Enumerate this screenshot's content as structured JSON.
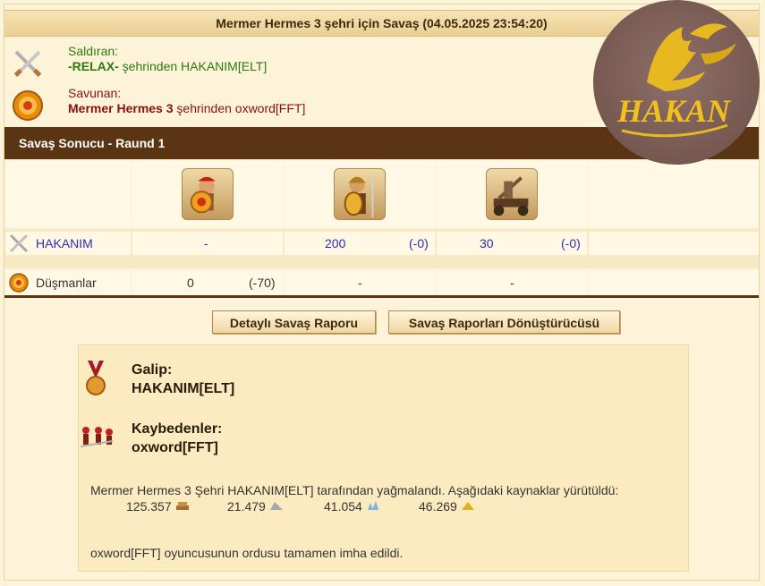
{
  "title": "Mermer Hermes 3 şehri için Savaş (04.05.2025 23:54:20)",
  "attacker": {
    "label": "Saldıran:",
    "city": "-RELAX-",
    "rest": " şehrinden HAKANIM[ELT]",
    "icon": "crossed-swords-icon"
  },
  "defender": {
    "label": "Savunan:",
    "city": "Mermer Hermes 3",
    "rest": " şehrinden oxword[FFT]",
    "icon": "shield-icon"
  },
  "result_title": "Savaş Sonucu - Raund 1",
  "units": [
    {
      "name": "unit-shield-warrior",
      "icon": "shield-warrior-icon"
    },
    {
      "name": "unit-spearman",
      "icon": "spearman-icon"
    },
    {
      "name": "unit-catapult",
      "icon": "catapult-icon"
    }
  ],
  "rows": {
    "attacker": {
      "name": "HAKANIM",
      "cells": [
        "-",
        "200",
        "(-0)",
        "30",
        "(-0)"
      ]
    },
    "defender": {
      "name": "Düşmanlar",
      "cells": [
        "0",
        "(-70)",
        "-",
        "-"
      ]
    }
  },
  "buttons": {
    "detail": "Detaylı Savaş Raporu",
    "converter": "Savaş Raporları Dönüştürücüsü"
  },
  "summary": {
    "winner_label": "Galip:",
    "winner": "HAKANIM[ELT]",
    "loser_label": "Kaybedenler:",
    "loser": "oxword[FFT]",
    "plunder_text": "Mermer Hermes 3 Şehri HAKANIM[ELT] tarafından yağmalandı. Aşağıdaki kaynaklar yürütüldü:",
    "resources": [
      {
        "value": "125.357",
        "icon": "wood-icon"
      },
      {
        "value": "21.479",
        "icon": "marble-icon"
      },
      {
        "value": "41.054",
        "icon": "crystal-icon"
      },
      {
        "value": "46.269",
        "icon": "sulfur-icon"
      }
    ],
    "destroyed_text": "oxword[FFT] oyuncusunun ordusu tamamen imha edildi."
  },
  "logo_text": "HAKAN"
}
